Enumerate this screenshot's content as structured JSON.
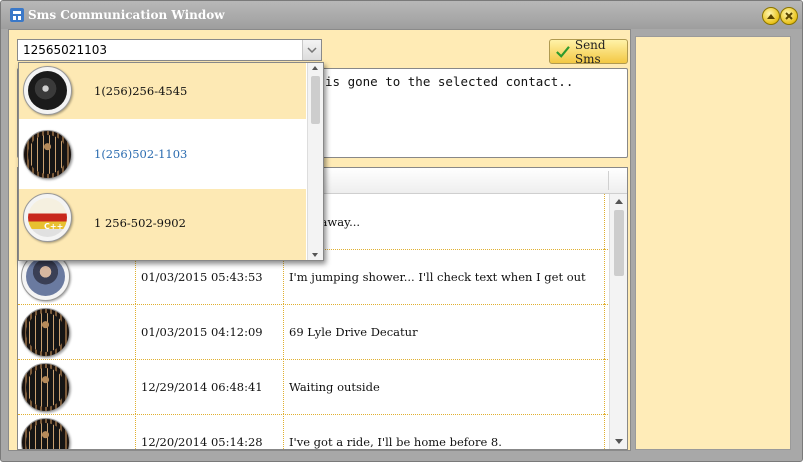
{
  "window": {
    "title": "Sms Communication Window"
  },
  "compose": {
    "recipient_value": "12565021103",
    "send_label": "Send Sms",
    "message_text": "is gone to the selected contact.."
  },
  "dropdown": {
    "items": [
      {
        "label": "1(256)256-4545",
        "avatar": "camera-photo-avatar",
        "selected": true,
        "label_color": "#111111"
      },
      {
        "label": "1(256)502-1103",
        "avatar": "piano-keys-avatar",
        "selected": false,
        "label_color": "#2b6cb0"
      },
      {
        "label": "1 256-502-9902",
        "avatar": "cpp-book-avatar",
        "selected": true,
        "label_color": "#111111",
        "avatar_text": "C++"
      }
    ]
  },
  "history": {
    "rows": [
      {
        "avatar": "piano-keys-avatar",
        "date": "",
        "message": "mins away..."
      },
      {
        "avatar": "person-avatar",
        "date": "01/03/2015 05:43:53",
        "message": "I'm jumping shower... I'll check text when I get out"
      },
      {
        "avatar": "piano-keys-avatar",
        "date": "01/03/2015 04:12:09",
        "message": "69 Lyle Drive Decatur"
      },
      {
        "avatar": "piano-keys-avatar",
        "date": "12/29/2014 06:48:41",
        "message": "Waiting outside"
      },
      {
        "avatar": "piano-keys-avatar",
        "date": "12/20/2014 05:14:28",
        "message": "I've got a ride, I'll be home before 8."
      }
    ]
  },
  "colors": {
    "panel_bg": "#ffebb5",
    "selected_item_bg": "#fde9b4",
    "button_gold": "#f3c844",
    "titlebar": "#a8a8a8"
  }
}
